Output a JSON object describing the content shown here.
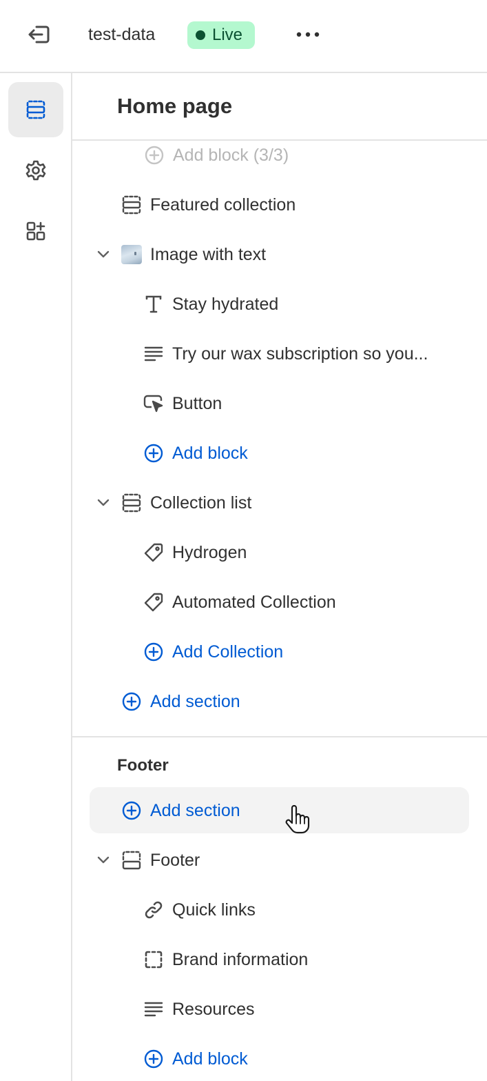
{
  "topbar": {
    "store_name": "test-data",
    "status_badge": "Live"
  },
  "rail": {
    "items": [
      {
        "name": "sections",
        "icon": "sections-icon",
        "active": true
      },
      {
        "name": "theme-settings",
        "icon": "gear-icon",
        "active": false
      },
      {
        "name": "app-embeds",
        "icon": "apps-add-icon",
        "active": false
      }
    ]
  },
  "panel": {
    "title": "Home page",
    "rows": {
      "add_block_disabled": "Add block (3/3)",
      "featured_collection": "Featured collection",
      "image_with_text": "Image with text",
      "stay_hydrated": "Stay hydrated",
      "try_wax": "Try our wax subscription so you...",
      "button": "Button",
      "add_block_1": "Add block",
      "collection_list": "Collection list",
      "hydrogen": "Hydrogen",
      "automated_collection": "Automated Collection",
      "add_collection": "Add Collection",
      "add_section_1": "Add section"
    },
    "footer_group": {
      "label": "Footer",
      "add_section": "Add section",
      "footer_section": "Footer",
      "quick_links": "Quick links",
      "brand_information": "Brand information",
      "resources": "Resources",
      "add_block": "Add block"
    }
  },
  "colors": {
    "accent_blue": "#005bd3",
    "live_badge_bg": "#b4f8cf",
    "live_badge_text": "#0c5132",
    "text": "#303030",
    "muted": "#b5b5b5"
  }
}
